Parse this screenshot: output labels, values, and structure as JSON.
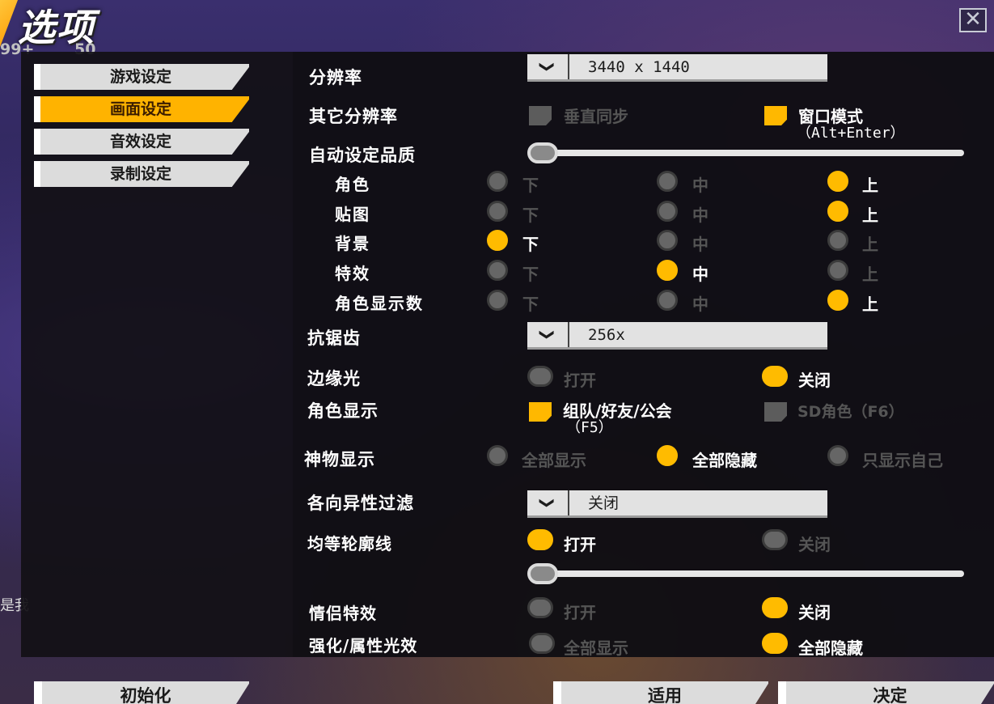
{
  "window": {
    "title": "选项",
    "close_glyph": "✕"
  },
  "top_badges": {
    "left": "99+",
    "right": "50"
  },
  "left_edge_text": "是我",
  "menu": [
    {
      "label": "游戏设定",
      "active": false
    },
    {
      "label": "画面设定",
      "active": true
    },
    {
      "label": "音效设定",
      "active": false
    },
    {
      "label": "录制设定",
      "active": false
    }
  ],
  "settings": {
    "resolution": {
      "label": "分辨率",
      "value": "3440 x 1440",
      "chevron": "❯"
    },
    "other_resolution": {
      "label": "其它分辨率",
      "vsync": {
        "label": "垂直同步",
        "checked": false
      },
      "window_mode": {
        "label": "窗口模式",
        "shortcut": "（Alt+Enter）",
        "checked": true
      }
    },
    "auto_quality": {
      "label": "自动设定品质",
      "level": 0
    },
    "quality": {
      "low": "下",
      "mid": "中",
      "high": "上",
      "rows": [
        {
          "label": "角色",
          "selected": "high"
        },
        {
          "label": "贴图",
          "selected": "high"
        },
        {
          "label": "背景",
          "selected": "low"
        },
        {
          "label": "特效",
          "selected": "mid"
        },
        {
          "label": "角色显示数",
          "selected": "high"
        }
      ]
    },
    "antialias": {
      "label": "抗锯齿",
      "value": "256x"
    },
    "rim_light": {
      "label": "边缘光",
      "on_label": "打开",
      "off_label": "关闭",
      "selected": "off"
    },
    "char_display": {
      "label": "角色显示",
      "party": {
        "label": "组队/好友/公会",
        "shortcut": "（F5）",
        "checked": true
      },
      "sd": {
        "label": "SD角色（F6）",
        "checked": false
      }
    },
    "artifact_display": {
      "label": "神物显示",
      "show_all": "全部显示",
      "hide_all": "全部隐藏",
      "self_only": "只显示自己",
      "selected": "hide_all"
    },
    "aniso": {
      "label": "各向异性过滤",
      "value": "关闭"
    },
    "outline": {
      "label": "均等轮廓线",
      "on_label": "打开",
      "off_label": "关闭",
      "selected": "on",
      "level": 0
    },
    "couple_fx": {
      "label": "情侣特效",
      "on_label": "打开",
      "off_label": "关闭",
      "selected": "off"
    },
    "enhance_fx": {
      "label": "强化/属性光效",
      "show_all": "全部显示",
      "hide_all": "全部隐藏",
      "selected": "hide_all"
    }
  },
  "buttons": {
    "reset": "初始化",
    "apply": "适用",
    "confirm": "决定"
  },
  "colors": {
    "accent": "#ffb300",
    "menu_bg": "#dcdcdc",
    "panel_bg": "#121016"
  }
}
